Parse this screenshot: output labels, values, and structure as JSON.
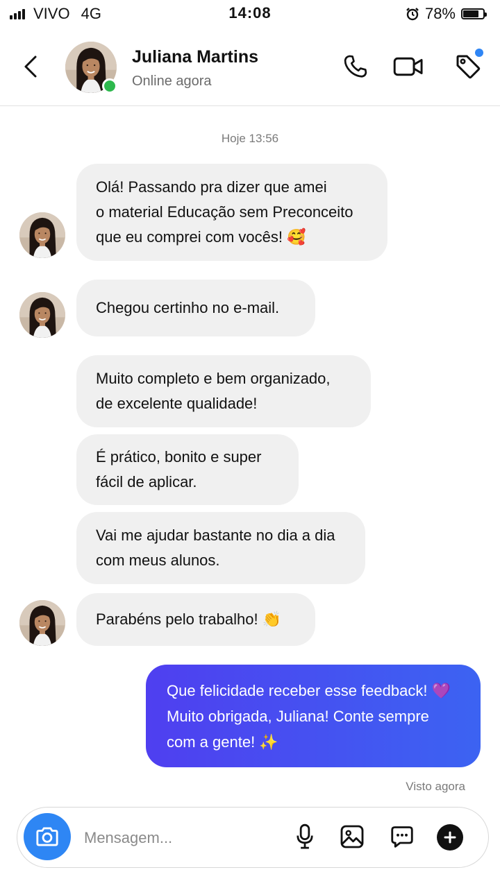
{
  "status_bar": {
    "carrier": "VIVO",
    "network": "4G",
    "time": "14:08",
    "battery": "78%",
    "battery_level": 0.78,
    "icons": [
      "signal-icon",
      "alarm-icon",
      "battery-icon"
    ]
  },
  "header": {
    "contact_name": "Juliana Martins",
    "status": "Online agora",
    "icons": [
      "back-icon",
      "phone-icon",
      "video-icon",
      "tag-icon"
    ]
  },
  "chat": {
    "timestamp": "Hoje 13:56",
    "incoming": [
      {
        "lines": [
          "Olá! Passando pra dizer que amei",
          "o material Educação sem Preconceito",
          "que eu comprei com vocês! 🥰"
        ],
        "avatar": true
      },
      {
        "lines": [
          "Chegou certinho no e-mail."
        ],
        "avatar": true
      },
      {
        "lines": [
          "Muito completo e bem organizado,",
          "de excelente qualidade!"
        ],
        "avatar": false
      },
      {
        "lines": [
          "É prático, bonito e super",
          "fácil de aplicar."
        ],
        "avatar": false
      },
      {
        "lines": [
          "Vai me ajudar bastante no dia a dia",
          "com meus alunos."
        ],
        "avatar": false
      },
      {
        "lines": [
          "Parabéns pelo trabalho! 👏"
        ],
        "avatar": true
      }
    ],
    "outgoing": {
      "lines": [
        "Que felicidade receber esse feedback! 💜",
        "Muito obrigada, Juliana! Conte sempre",
        "com a gente! ✨"
      ]
    },
    "seen_label": "Visto agora"
  },
  "composer": {
    "placeholder": "Mensagem...",
    "icons": [
      "camera-icon",
      "microphone-icon",
      "image-icon",
      "sticker-icon",
      "plus-icon"
    ]
  },
  "colors": {
    "outgoing_bubble_start": "#4f3ff0",
    "outgoing_bubble_end": "#3c63f2",
    "incoming_bubble": "#f0f0f0",
    "camera_button": "#2e86f4",
    "online": "#2db84d"
  }
}
